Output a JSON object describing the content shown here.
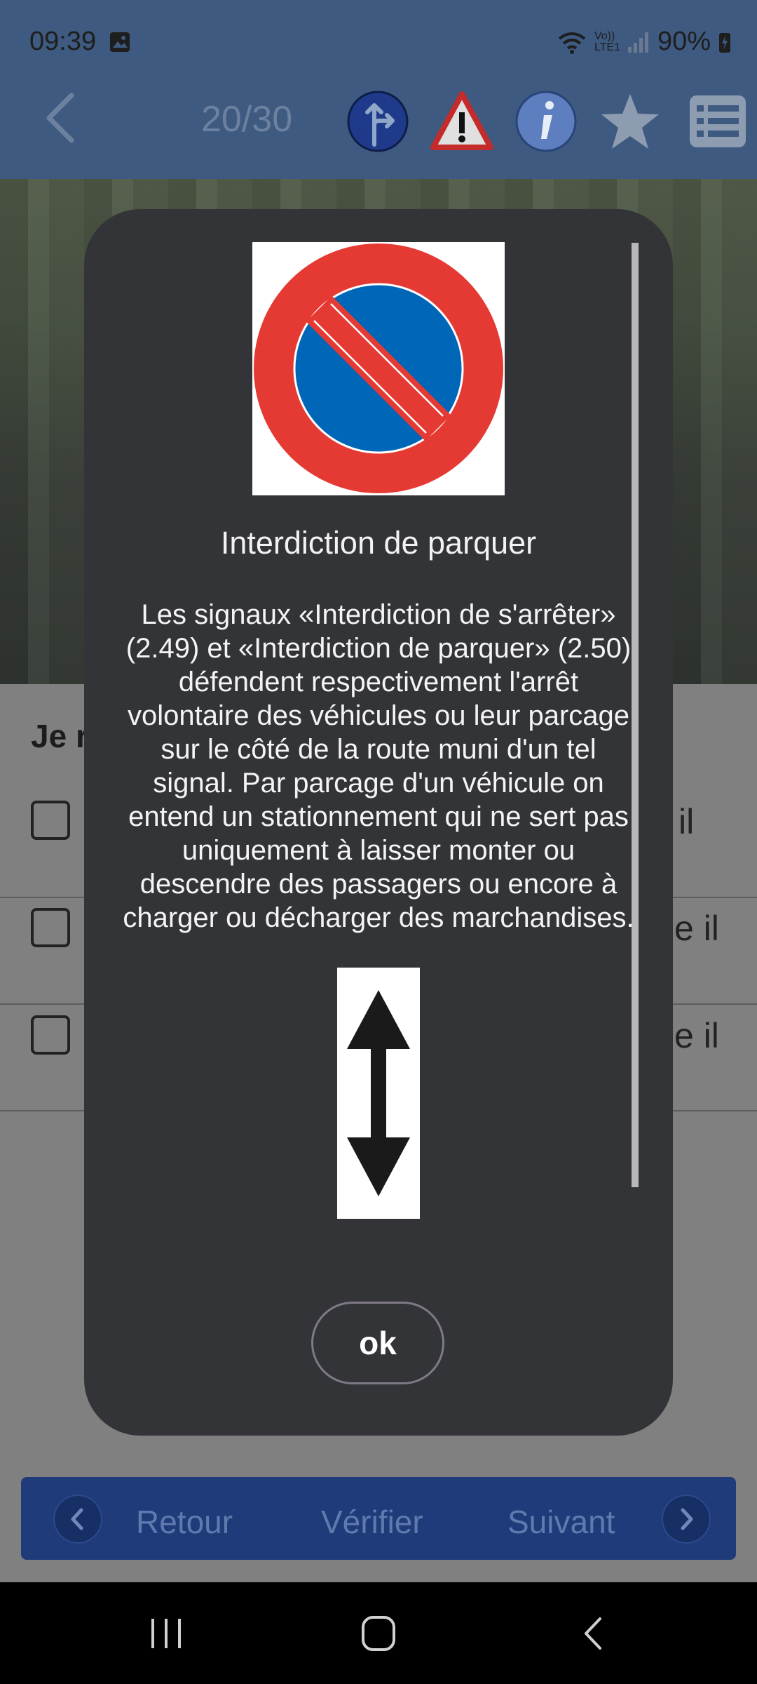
{
  "status_bar": {
    "time": "09:39",
    "network_label": "Vo)) LTE1",
    "battery": "90%"
  },
  "header": {
    "counter": "20/30",
    "icons": [
      "back-chevron-icon",
      "direction-sign-icon",
      "warning-triangle-icon",
      "info-icon",
      "star-icon",
      "list-icon"
    ]
  },
  "question": {
    "text_visible": "Je r",
    "answers": [
      {
        "tail": "il"
      },
      {
        "tail": "e il"
      },
      {
        "tail": "e il"
      }
    ]
  },
  "dialog": {
    "title": "Interdiction de parquer",
    "body_lines": [
      "Les signaux «Interdiction de s'arrêter»",
      "(2.49) et «Interdiction de parquer» (2.50)",
      "défendent respectivement l'arrêt",
      "volontaire des véhicules ou leur parcage",
      "sur le côté de la route muni d'un tel",
      "signal. Par parcage d'un véhicule on",
      "entend un stationnement qui ne sert pas",
      "uniquement à laisser monter ou",
      "descendre des passagers ou encore à",
      "charger ou décharger des marchandises."
    ],
    "ok_label": "ok"
  },
  "bottom_nav": {
    "back_label": "Retour",
    "verify_label": "Vérifier",
    "next_label": "Suivant"
  },
  "colors": {
    "header_bg": "#3e5a80",
    "dialog_bg": "#333437",
    "nav_bg": "#1f3b7a",
    "sign_red": "#e53a33",
    "sign_blue": "#0067b8"
  }
}
